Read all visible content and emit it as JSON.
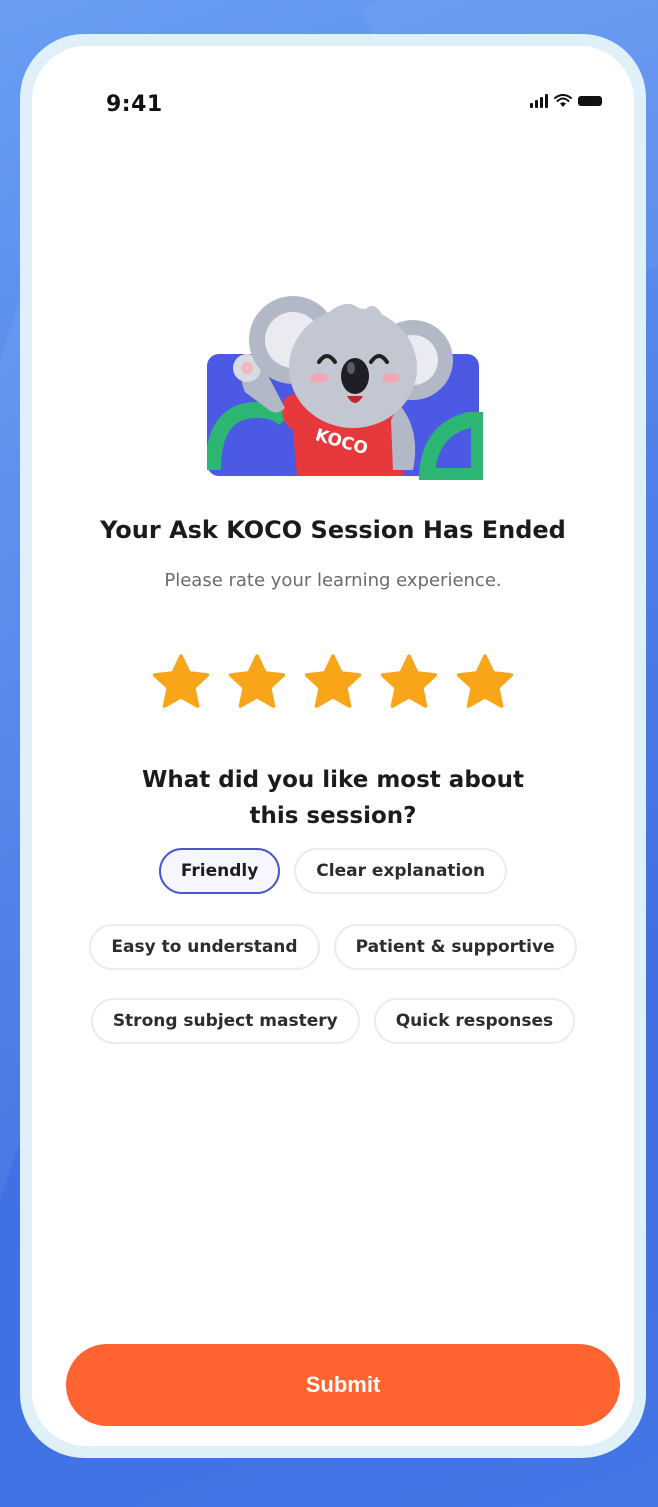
{
  "status_bar": {
    "time": "9:41",
    "icons": [
      "signal-icon",
      "wifi-icon",
      "battery-icon"
    ]
  },
  "hero": {
    "illustration": "koala-mascot-waving",
    "shirt_text": "KOCO"
  },
  "session": {
    "title": "Your Ask KOCO Session Has Ended",
    "subtitle": "Please rate your learning experience."
  },
  "rating": {
    "value": 5,
    "max": 5,
    "star_color": "#f9a51a"
  },
  "feedback": {
    "question": "What did you like most about this session?",
    "options": [
      {
        "label": "Friendly",
        "selected": true
      },
      {
        "label": "Clear explanation",
        "selected": false
      },
      {
        "label": "Easy to understand",
        "selected": false
      },
      {
        "label": "Patient & supportive",
        "selected": false
      },
      {
        "label": "Strong subject mastery",
        "selected": false
      },
      {
        "label": "Quick responses",
        "selected": false
      }
    ]
  },
  "actions": {
    "submit_label": "Submit",
    "accent_color": "#ff6430"
  }
}
